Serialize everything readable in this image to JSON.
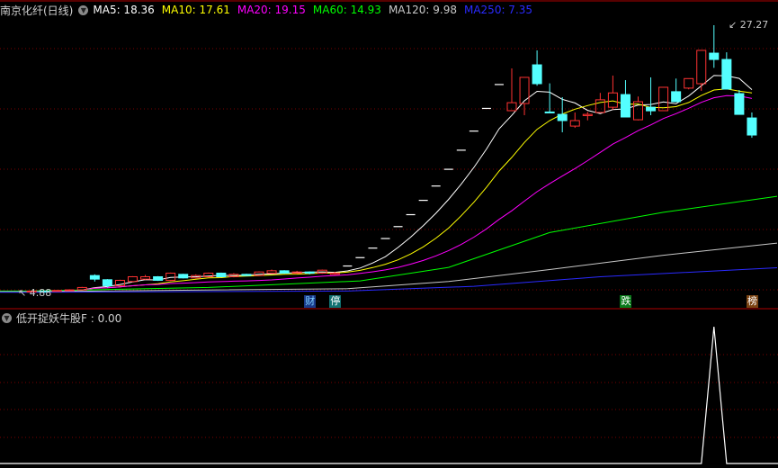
{
  "header": {
    "title": "南京化纤(日线)",
    "ma": [
      {
        "label": "MA5: 18.36",
        "color": "#ffffff"
      },
      {
        "label": "MA10: 17.61",
        "color": "#ffff00"
      },
      {
        "label": "MA20: 19.15",
        "color": "#ff00ff"
      },
      {
        "label": "MA60: 14.93",
        "color": "#00ff00"
      },
      {
        "label": "MA120: 9.98",
        "color": "#c8c8c8"
      },
      {
        "label": "MA250: 7.35",
        "color": "#2a2aff"
      }
    ]
  },
  "indicator": {
    "label": "低开捉妖牛股F : 0.00"
  },
  "labels": {
    "high": "27.27",
    "low": "4.88"
  },
  "markers": [
    {
      "text": "财",
      "index": 22,
      "bg": "#1a3a8a",
      "fg": "#7fd0ff"
    },
    {
      "text": "停",
      "index": 24,
      "bg": "#107070",
      "fg": "#ffffff"
    },
    {
      "text": "跌",
      "index": 47,
      "bg": "#0a7a1a",
      "fg": "#ffffff"
    },
    {
      "text": "榜",
      "index": 57,
      "bg": "#7a4210",
      "fg": "#ffffff"
    }
  ],
  "colors": {
    "up": "#ff3232",
    "down": "#54ffff",
    "flat": "#ffffff",
    "grid": "#7a0000",
    "border": "#b00000"
  },
  "chart_data": {
    "type": "candlestick",
    "price_range": [
      4.88,
      27.27
    ],
    "candles": [
      [
        4.95,
        5.0,
        5.02,
        4.88
      ],
      [
        5.0,
        4.98,
        5.03,
        4.95
      ],
      [
        4.98,
        5.05,
        5.08,
        4.96
      ],
      [
        5.05,
        5.1,
        5.15,
        5.0
      ],
      [
        5.1,
        5.3,
        5.35,
        5.08
      ],
      [
        6.3,
        6.0,
        6.4,
        5.8
      ],
      [
        5.95,
        5.45,
        6.0,
        5.3
      ],
      [
        5.45,
        5.9,
        5.95,
        5.4
      ],
      [
        5.8,
        6.2,
        6.25,
        5.75
      ],
      [
        6.0,
        6.2,
        6.35,
        5.95
      ],
      [
        6.2,
        5.9,
        6.25,
        5.85
      ],
      [
        5.9,
        6.5,
        6.55,
        5.85
      ],
      [
        6.4,
        6.1,
        6.45,
        6.05
      ],
      [
        6.1,
        6.3,
        6.4,
        6.05
      ],
      [
        6.2,
        6.5,
        6.55,
        6.15
      ],
      [
        6.5,
        6.2,
        6.55,
        6.15
      ],
      [
        6.2,
        6.4,
        6.5,
        6.15
      ],
      [
        6.4,
        6.3,
        6.45,
        6.25
      ],
      [
        6.3,
        6.6,
        6.65,
        6.25
      ],
      [
        6.5,
        6.7,
        6.8,
        6.45
      ],
      [
        6.7,
        6.5,
        6.75,
        6.45
      ],
      [
        6.5,
        6.6,
        6.7,
        6.45
      ],
      [
        6.6,
        6.5,
        6.65,
        6.4
      ],
      [
        6.5,
        6.75,
        6.8,
        6.45
      ],
      [
        6.4,
        6.5,
        6.6,
        6.35
      ],
      [
        7.1,
        7.1,
        7.1,
        7.1
      ],
      [
        7.8,
        7.8,
        7.8,
        7.8
      ],
      [
        8.6,
        8.6,
        8.6,
        8.6
      ],
      [
        9.4,
        9.4,
        9.4,
        9.4
      ],
      [
        10.4,
        10.4,
        10.4,
        10.4
      ],
      [
        11.4,
        11.4,
        11.4,
        11.4
      ],
      [
        12.6,
        12.6,
        12.6,
        12.6
      ],
      [
        13.8,
        13.8,
        13.8,
        13.8
      ],
      [
        15.2,
        15.2,
        15.2,
        15.2
      ],
      [
        16.8,
        16.8,
        16.8,
        16.8
      ],
      [
        18.4,
        18.4,
        18.4,
        18.4
      ],
      [
        20.3,
        20.3,
        20.3,
        20.3
      ],
      [
        22.3,
        22.3,
        22.3,
        22.3
      ],
      [
        20.11,
        20.78,
        23.65,
        20.11
      ],
      [
        20.71,
        22.9,
        22.9,
        19.73
      ],
      [
        23.95,
        22.37,
        25.16,
        22.2
      ],
      [
        20.0,
        19.95,
        22.4,
        19.95
      ],
      [
        19.8,
        19.28,
        21.24,
        18.3
      ],
      [
        18.82,
        19.28,
        19.96,
        18.67
      ],
      [
        19.7,
        19.8,
        20.0,
        19.3
      ],
      [
        19.96,
        21.02,
        21.6,
        19.96
      ],
      [
        20.4,
        21.6,
        23.05,
        20.2
      ],
      [
        21.46,
        19.58,
        22.67,
        19.58
      ],
      [
        19.35,
        20.86,
        21.3,
        19.3
      ],
      [
        20.4,
        20.1,
        22.9,
        19.73
      ],
      [
        20.11,
        22.07,
        22.07,
        20.11
      ],
      [
        21.7,
        20.86,
        22.8,
        20.86
      ],
      [
        22.0,
        22.8,
        22.8,
        21.9
      ],
      [
        22.37,
        25.16,
        25.16,
        21.77
      ],
      [
        24.93,
        24.4,
        27.27,
        23.7
      ],
      [
        24.4,
        21.92,
        25.0,
        21.92
      ],
      [
        21.54,
        19.8,
        21.84,
        19.8
      ],
      [
        19.5,
        18.07,
        19.96,
        17.84
      ]
    ],
    "ma_long": {
      "MA60": [
        [
          0,
          5.0
        ],
        [
          14,
          5.3
        ],
        [
          26,
          5.85
        ],
        [
          33,
          6.98
        ],
        [
          41,
          9.9
        ],
        [
          50,
          11.6
        ],
        [
          59,
          12.94
        ]
      ],
      "MA120": [
        [
          0,
          4.95
        ],
        [
          25,
          5.2
        ],
        [
          33,
          5.8
        ],
        [
          41,
          6.8
        ],
        [
          50,
          8.0
        ],
        [
          59,
          9.02
        ]
      ],
      "MA250": [
        [
          0,
          4.9
        ],
        [
          25,
          5.0
        ],
        [
          35,
          5.4
        ],
        [
          45,
          6.2
        ],
        [
          59,
          6.95
        ]
      ]
    },
    "indicator_values": [
      0,
      0,
      0,
      0,
      0,
      0,
      0,
      0,
      0,
      0,
      0,
      0,
      0,
      0,
      0,
      0,
      0,
      0,
      0,
      0,
      0,
      0,
      0,
      0,
      0,
      0,
      0,
      0,
      0,
      0,
      0,
      0,
      0,
      0,
      0,
      0,
      0,
      0,
      0,
      0,
      0,
      0,
      0,
      0,
      0,
      0,
      0,
      0,
      0,
      0,
      0,
      0,
      0,
      0,
      1,
      0,
      0,
      0,
      0,
      0
    ],
    "indicator_range": [
      0,
      1
    ]
  }
}
